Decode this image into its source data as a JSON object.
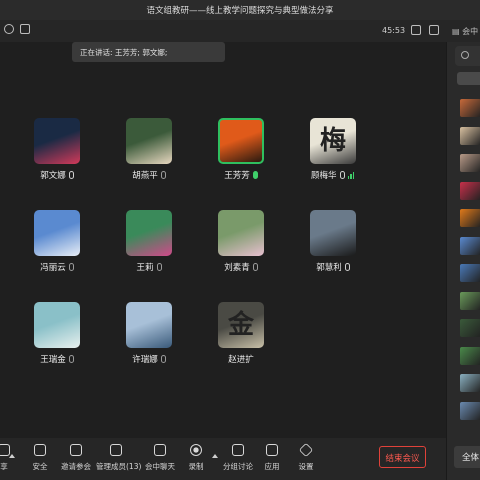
{
  "window": {
    "title": "语文组教研——线上教学问题探究与典型做法分享"
  },
  "topbar": {
    "timer": "45:53",
    "chat_tab": "会中"
  },
  "speaking": {
    "text": "正在讲话: 王芳芳; 郭文娜;"
  },
  "participants": [
    {
      "name": "郭文娜",
      "mic": "on-gray",
      "active": false,
      "colors": [
        "#1a2a44",
        "#d23a5a"
      ]
    },
    {
      "name": "胡燕平",
      "mic": "muted",
      "active": false,
      "colors": [
        "#3b5a3a",
        "#e8d8c0"
      ]
    },
    {
      "name": "王芳芳",
      "mic": "speaking",
      "active": true,
      "colors": [
        "#e05a1a",
        "#2a1a10"
      ]
    },
    {
      "name": "顾梅华",
      "mic": "on-gray",
      "active": false,
      "level": "3",
      "avatar_text": "梅",
      "colors": [
        "#e8e4d6",
        "#3a3a3a"
      ]
    },
    {
      "name": "冯丽云",
      "mic": "muted",
      "active": false,
      "colors": [
        "#5a8ad0",
        "#e8eef6"
      ]
    },
    {
      "name": "王莉",
      "mic": "muted",
      "active": false,
      "colors": [
        "#3a8a5a",
        "#d04a8a"
      ]
    },
    {
      "name": "刘素青",
      "mic": "muted",
      "active": false,
      "colors": [
        "#7a9a6a",
        "#e8c0d0"
      ]
    },
    {
      "name": "郭慧利",
      "mic": "on-gray",
      "active": false,
      "colors": [
        "#6a7a8a",
        "#1a1a1a"
      ]
    },
    {
      "name": "王瑞金",
      "mic": "muted",
      "active": false,
      "colors": [
        "#8ac0c8",
        "#e8f0ee"
      ]
    },
    {
      "name": "许瑞娜",
      "mic": "muted",
      "active": false,
      "colors": [
        "#a8c0d8",
        "#3a5a7a"
      ]
    },
    {
      "name": "赵进扩",
      "mic": "none",
      "active": false,
      "avatar_text": "金",
      "colors": [
        "#4a4a44",
        "#c8c0a8"
      ]
    }
  ],
  "sidebar": {
    "avatar_colors": [
      "#c86a3a",
      "#d8c0a0",
      "#b89a88",
      "#c8304a",
      "#e07a1a",
      "#5a8ad0",
      "#4a7ab8",
      "#6a9a5a",
      "#3a5a3a",
      "#4a8a4a",
      "#8ab0c0",
      "#6a8ab0"
    ],
    "all_mute_label": "全体"
  },
  "toolbar": {
    "items": [
      {
        "label": "享",
        "icon": "share-icon"
      },
      {
        "label": "安全",
        "icon": "shield-icon"
      },
      {
        "label": "邀请参会",
        "icon": "invite-icon"
      },
      {
        "label": "管理成员(13)",
        "icon": "members-icon"
      },
      {
        "label": "会中聊天",
        "icon": "chat-icon"
      },
      {
        "label": "录制",
        "icon": "record-icon"
      },
      {
        "label": "分组讨论",
        "icon": "breakout-icon"
      },
      {
        "label": "应用",
        "icon": "apps-icon"
      },
      {
        "label": "设置",
        "icon": "settings-icon"
      }
    ],
    "end_label": "结束会议"
  }
}
